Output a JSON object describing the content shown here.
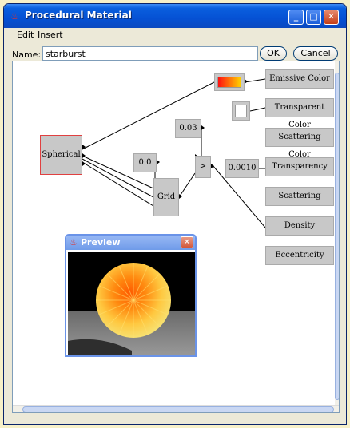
{
  "window": {
    "title": "Procedural Material",
    "minimize_glyph": "_",
    "maximize_glyph": "□",
    "close_glyph": "✕"
  },
  "menu": [
    "Edit",
    "Insert"
  ],
  "name_field": {
    "label": "Name:",
    "value": "starburst"
  },
  "buttons": {
    "ok": "OK",
    "cancel": "Cancel"
  },
  "nodes": {
    "spherical": "Spherical",
    "val_003": "0.03",
    "val_00": "0.0",
    "greater": ">",
    "grid": "Grid",
    "val_0010": "0.0010"
  },
  "properties": [
    "Emissive Color",
    "Transparent Color",
    "Scattering Color",
    "Transparency",
    "Scattering",
    "Density",
    "Eccentricity"
  ],
  "preview": {
    "title": "Preview",
    "close_glyph": "✕"
  },
  "colors": {
    "port_input": "#cc00cc",
    "port_output": "#000000",
    "node_bg": "#c8c8c8",
    "selected_node_border": "#e04040",
    "gradient_start": "#ff1010",
    "gradient_end": "#ffd000"
  }
}
